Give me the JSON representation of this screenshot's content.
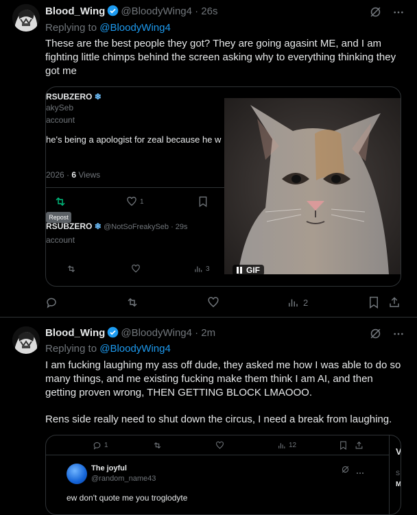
{
  "post1": {
    "name": "Blood_Wing",
    "handle": "@BloodyWing4",
    "time": "· 26s",
    "reply_prefix": "Replying to",
    "reply_to": "@BloodyWing4",
    "text": "These are the best people they got? They are going agasint ME, and I am fighting little chimps behind the screen asking why to everything thinking they got me",
    "embed": {
      "name1": "RSUBZERO",
      "handle1": "akySeb",
      "sub1": "account",
      "text1": "he's being a apologist for zeal because he w",
      "stats": "2026 · ",
      "views_num": "6",
      "views_label": " Views",
      "like_count": "1",
      "tooltip": "Repost",
      "name2": "RSUBZERO",
      "handle2": "@NotSoFreakySeb · 29s",
      "sub2": "account",
      "view_count2": "3",
      "gif_label": "GIF"
    },
    "views": "2"
  },
  "post2": {
    "name": "Blood_Wing",
    "handle": "@BloodyWing4",
    "time": "· 2m",
    "reply_prefix": "Replying to",
    "reply_to": "@BloodyWing4",
    "text1": "I am fucking laughing my ass off dude, they asked me how I was able to do so many things, and me existing fucking make them think I am AI, and then getting proven wrong, THEN GETTING BLOCK LMAOOO.",
    "text2": "Rens side really need to shut down the circus, I need a break from laughing.",
    "embed": {
      "reply_count": "1",
      "view_count": "12",
      "name": "The joyful",
      "handle": "@random_name43",
      "text": "ew don't quote me you troglodyte",
      "edge_a": "V",
      "edge_b": "S",
      "edge_c": "M"
    }
  },
  "colors": {
    "accent": "#1d9bf0",
    "muted": "#71767b",
    "text": "#e7e9ea",
    "border": "#2f3336",
    "repost": "#00ba7c"
  }
}
